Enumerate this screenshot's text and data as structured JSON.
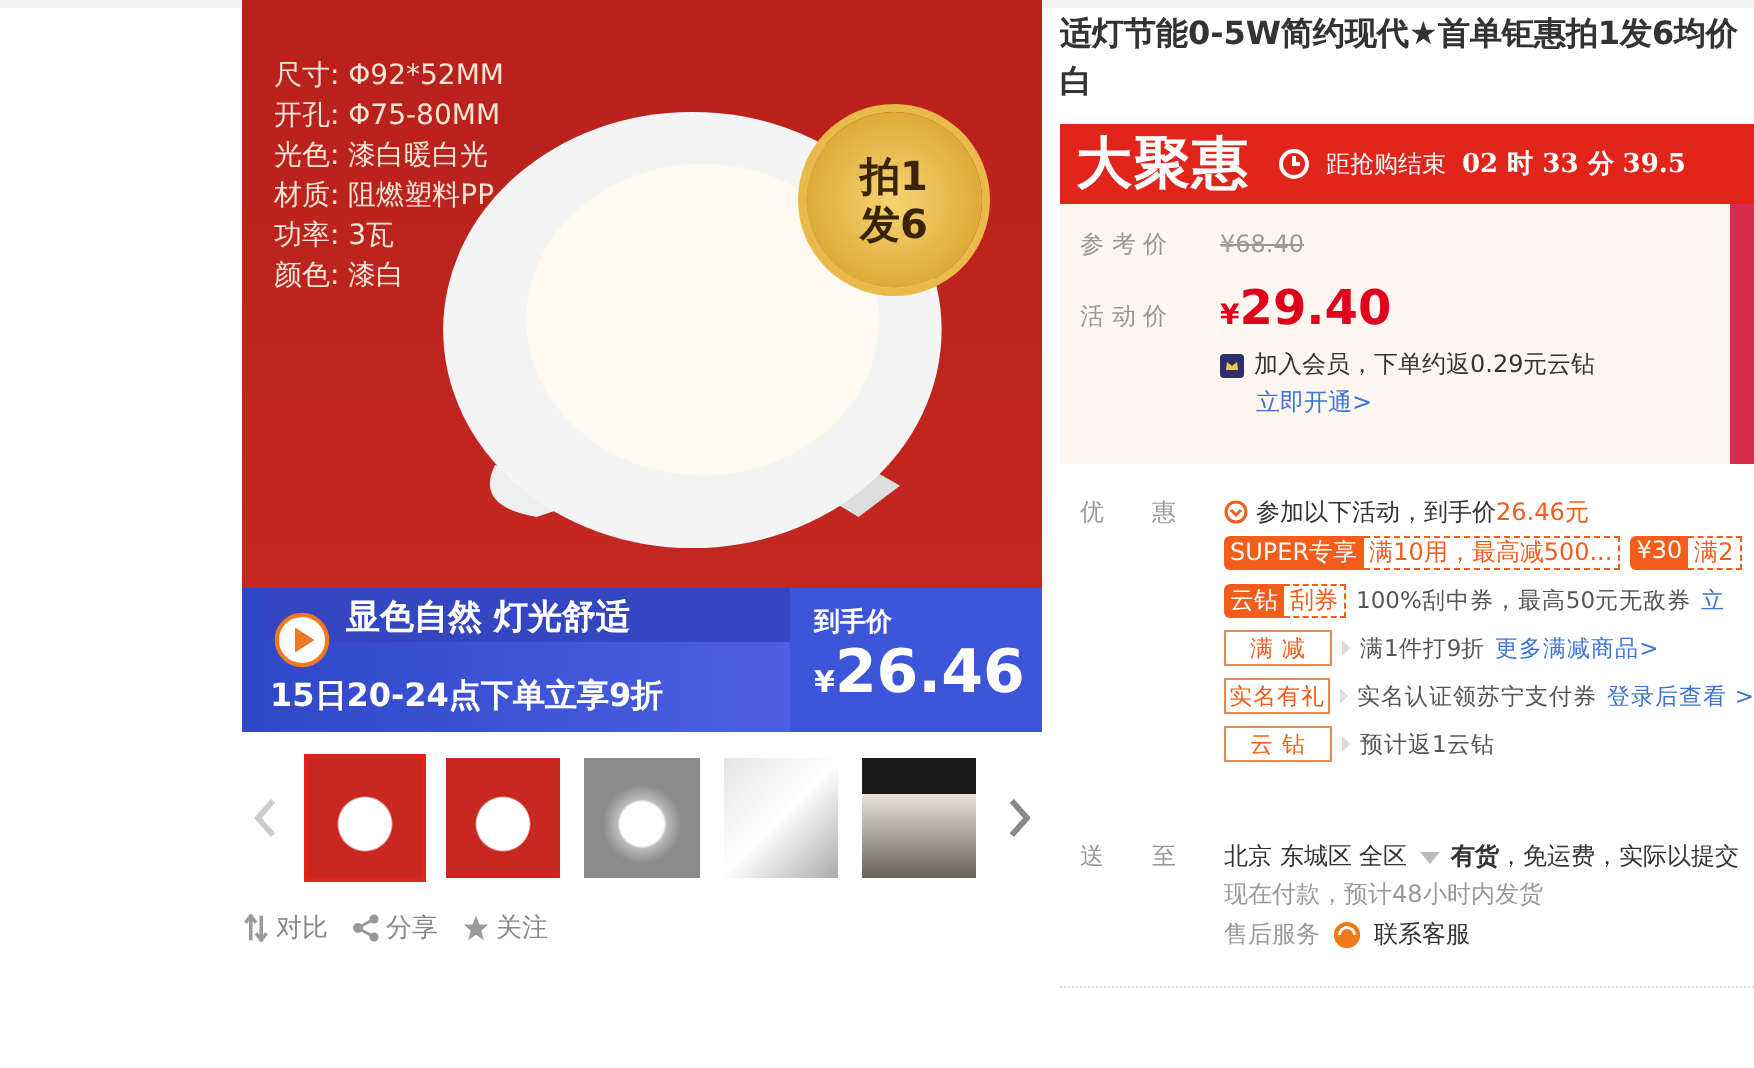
{
  "title": {
    "lines": [
      "适灯节能0-5W简约现代★首单钜惠拍1发6均价",
      "白"
    ]
  },
  "product_image": {
    "specs": [
      "尺寸: Φ92*52MM",
      "开孔: Φ75-80MM",
      "光色: 漆白暖白光",
      "材质: 阻燃塑料PP",
      "功率: 3瓦",
      "颜色: 漆白"
    ],
    "badge": [
      "拍1",
      "发6"
    ],
    "slogan": "显色自然 灯光舒适",
    "promo": "15日20-24点下单立享9折",
    "final_price_label": "到手价",
    "final_price_symbol": "¥",
    "final_price": "26.46"
  },
  "thumbnails": [
    {
      "kind": "red",
      "selected": true
    },
    {
      "kind": "red",
      "selected": false
    },
    {
      "kind": "gray",
      "selected": false
    },
    {
      "kind": "white",
      "selected": false
    },
    {
      "kind": "dark",
      "selected": false
    }
  ],
  "actions": [
    {
      "kind": "compare",
      "label": "对比"
    },
    {
      "kind": "share",
      "label": "分享"
    },
    {
      "kind": "star",
      "label": "关注"
    }
  ],
  "flash_sale": {
    "brand": "大聚惠",
    "countdown_label": "距抢购结束",
    "countdown": "02 时 33 分 39.5"
  },
  "prices": [
    {
      "kind": "reference",
      "label": "参 考 价",
      "value": "¥68.40"
    },
    {
      "kind": "active",
      "label": "活 动 价",
      "symbol": "¥",
      "value": "29.40"
    }
  ],
  "member": {
    "text": "加入会员，下单约返0.29元云钻",
    "link": "立即开通>"
  },
  "promotions": {
    "label": "优　　惠",
    "summary": "参加以下活动，到手价",
    "summary_price": "26.46元",
    "rows": [
      {
        "kind": "coupon",
        "tags": [
          {
            "solid": "SUPER专享",
            "outline": "满10用，最高减500..."
          },
          {
            "solid": "¥30",
            "outline": "满2"
          }
        ]
      },
      {
        "kind": "coupon",
        "tags": [
          {
            "solid": "云钻",
            "outline": "刮券"
          }
        ],
        "text": "100%刮中券，最高50元无敌券",
        "link": "立"
      },
      {
        "kind": "rule",
        "tag": "满 减",
        "text": "满1件打9折",
        "link": "更多满减商品>"
      },
      {
        "kind": "rule",
        "tag": "实名有礼",
        "text": "实名认证领苏宁支付券",
        "link": "登录后查看 >"
      },
      {
        "kind": "rule",
        "tag": "云 钻",
        "text": "预计返1云钻"
      }
    ]
  },
  "delivery": {
    "label": "送　　至",
    "location": "北京 东城区 全区",
    "stock": "有货",
    "note": "，免运费，实际以提交",
    "eta": "现在付款，预计48小时内发货",
    "service": "售后服务",
    "contact": "联系客服"
  }
}
